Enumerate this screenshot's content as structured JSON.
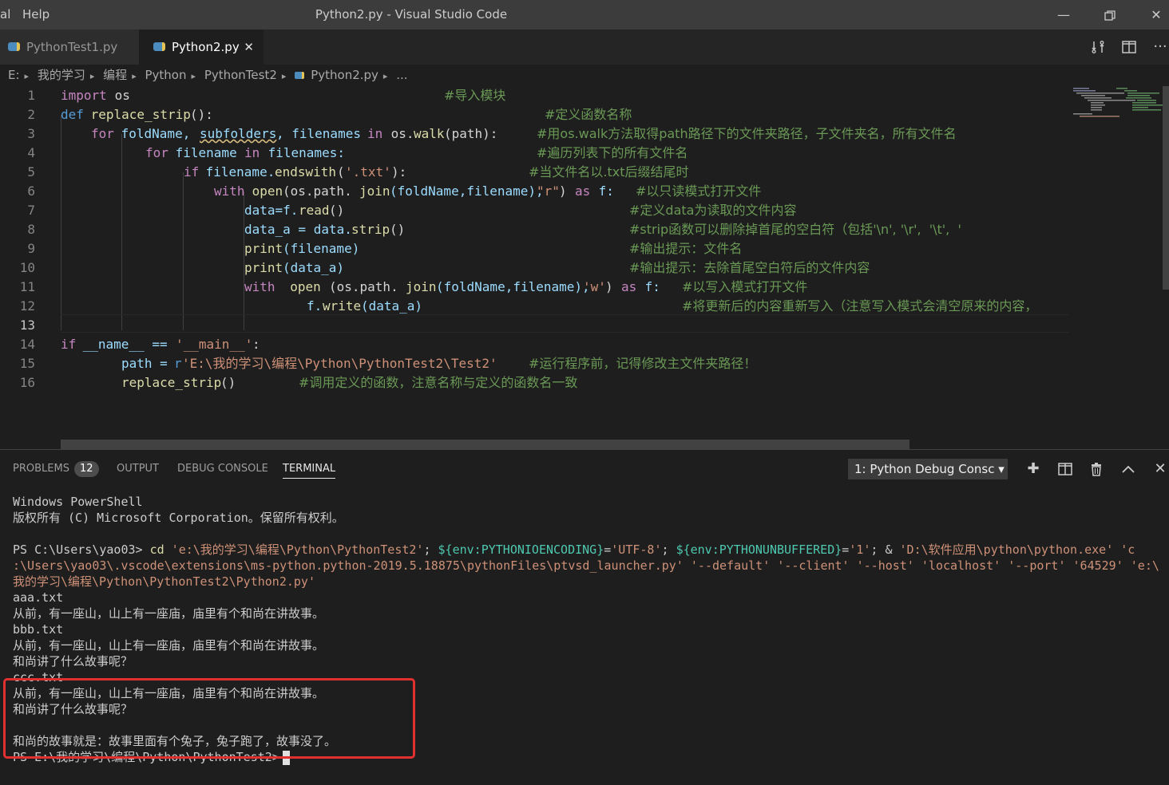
{
  "titlebar": {
    "menu_partial": "al",
    "menu_help": "Help",
    "title": "Python2.py - Visual Studio Code",
    "minimize": "—",
    "maximize": "❐",
    "close": "✕"
  },
  "tabs": [
    {
      "label": "PythonTest1.py",
      "active": false
    },
    {
      "label": "Python2.py",
      "active": true,
      "close": "✕"
    }
  ],
  "breadcrumb": [
    "E:",
    "我的学习",
    "编程",
    "Python",
    "PythonTest2",
    "Python2.py",
    "..."
  ],
  "editor": {
    "current_line": 13,
    "lines": [
      {
        "n": "1"
      },
      {
        "n": "2"
      },
      {
        "n": "3"
      },
      {
        "n": "4"
      },
      {
        "n": "5"
      },
      {
        "n": "6"
      },
      {
        "n": "7"
      },
      {
        "n": "8"
      },
      {
        "n": "9"
      },
      {
        "n": "10"
      },
      {
        "n": "11"
      },
      {
        "n": "12"
      },
      {
        "n": "13"
      },
      {
        "n": "14"
      },
      {
        "n": "15"
      },
      {
        "n": "16"
      }
    ],
    "code": {
      "l1_kw": "import",
      "l1_mod": " os",
      "l1_cm": "#导入模块",
      "l2_kw": "def",
      "l2_fn": " replace_strip",
      "l2_p": "():",
      "l2_cm": "#定义函数名称",
      "l3_kw": "for",
      "l3_a": " foldName, ",
      "l3_b": "subfolders",
      "l3_c": ", filenames ",
      "l3_in": "in",
      "l3_d": " os.",
      "l3_fn": "walk",
      "l3_e": "(path):",
      "l3_cm": "#用os.walk方法取得path路径下的文件夹路径，子文件夹名，所有文件名",
      "l4_kw": "for",
      "l4_a": " filename ",
      "l4_in": "in",
      "l4_b": " filenames:",
      "l4_cm": "#遍历列表下的所有文件名",
      "l5_kw": "if",
      "l5_a": " filename.",
      "l5_fn": "endswith",
      "l5_b": "(",
      "l5_s": "'.txt'",
      "l5_c": "):",
      "l5_cm": "#当文件名以.txt后缀结尾时",
      "l6_kw": "with",
      "l6_fn": " open",
      "l6_a": "(os.path.",
      "l6_fn2": "join",
      "l6_b": "(foldName,filename),",
      "l6_s": "\"r\"",
      "l6_c": ") ",
      "l6_as": "as",
      "l6_d": " f:",
      "l6_cm": "#以只读模式打开文件",
      "l7_a": "data=f.",
      "l7_fn": "read",
      "l7_b": "()",
      "l7_cm": "#定义data为读取的文件内容",
      "l8_a": "data_a = data.",
      "l8_fn": "strip",
      "l8_b": "()",
      "l8_cm": "#strip函数可以删除掉首尾的空白符（包括'\\n', '\\r',  '\\t',  '",
      "l9_fn": "print",
      "l9_a": "(filename)",
      "l9_cm": "#输出提示：文件名",
      "l10_fn": "print",
      "l10_a": "(data_a)",
      "l10_cm": "#输出提示：去除首尾空白符后的文件内容",
      "l11_kw": "with",
      "l11_fn": "  open",
      "l11_a": "(os.path.",
      "l11_fn2": "join",
      "l11_b": "(foldName,filename), ",
      "l11_s": "'w'",
      "l11_c": ") ",
      "l11_as": "as",
      "l11_d": " f:",
      "l11_cm": "#以写入模式打开文件",
      "l12_a": "f.",
      "l12_fn": "write",
      "l12_b": "(data_a)",
      "l12_cm": "#将更新后的内容重新写入（注意写入模式会清空原来的内容，",
      "l14_kw": "if",
      "l14_a": " __name__ == ",
      "l14_s": "'__main__'",
      "l14_b": ":",
      "l15_a": "path = ",
      "l15_r": "r",
      "l15_s": "'E:\\我的学习\\编程\\Python\\PythonTest2\\Test2'",
      "l15_cm": "#运行程序前，记得修改主文件夹路径！",
      "l16_fn": "replace_strip",
      "l16_a": "()",
      "l16_cm": "#调用定义的函数，注意名称与定义的函数名一致"
    }
  },
  "panel": {
    "tabs": {
      "problems": "PROBLEMS",
      "problems_count": "12",
      "output": "OUTPUT",
      "debug": "DEBUG CONSOLE",
      "terminal": "TERMINAL"
    },
    "terminal_select": "1: Python Debug Consc ▾",
    "actions": {
      "add": "✚",
      "split": "◫",
      "trash": "Ὕ1",
      "up": "⌃",
      "close": "✕"
    }
  },
  "terminal": {
    "l1": "Windows PowerShell",
    "l2": "版权所有 (C) Microsoft Corporation。保留所有权利。",
    "cmd_prompt": "PS C:\\Users\\yao03> ",
    "cmd_cd": "cd",
    "cmd_a": " 'e:\\我的学习\\编程\\Python\\PythonTest2'",
    "cmd_b": "; ",
    "cmd_env1": "${env:PYTHONIOENCODING}",
    "cmd_c": "=",
    "cmd_s1": "'UTF-8'",
    "cmd_d": "; ",
    "cmd_env2": "${env:PYTHONUNBUFFERED}",
    "cmd_e": "=",
    "cmd_s2": "'1'",
    "cmd_f": "; & ",
    "cmd_s3": "'D:\\软件应用\\python\\python.exe' 'c",
    "cmd_line2": ":\\Users\\yao03\\.vscode\\extensions\\ms-python.python-2019.5.18875\\pythonFiles\\ptvsd_launcher.py' '--default' '--client' '--host' 'localhost' '--port' '64529' 'e:\\",
    "cmd_line3": "我的学习\\编程\\Python\\PythonTest2\\Python2.py'",
    "o1": "aaa.txt",
    "o2": "从前，有一座山，山上有一座庙，庙里有个和尚在讲故事。",
    "o3": "bbb.txt",
    "o4": "从前，有一座山，山上有一座庙，庙里有个和尚在讲故事。",
    "o5": "和尚讲了什么故事呢？",
    "o6": "ccc.txt",
    "o7": "从前，有一座山，山上有一座庙，庙里有个和尚在讲故事。",
    "o8": "和尚讲了什么故事呢？",
    "o9": "和尚的故事就是：故事里面有个兔子，兔子跑了，故事没了。",
    "prompt": "PS E:\\我的学习\\编程\\Python\\PythonTest2>"
  },
  "colors": {
    "red_box": "#e03030",
    "accent": "#007acc"
  }
}
